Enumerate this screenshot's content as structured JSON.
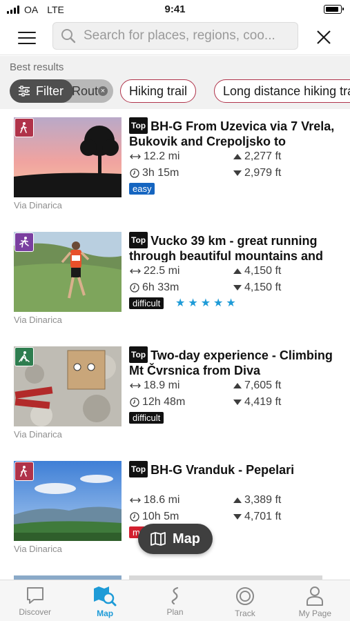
{
  "status_bar": {
    "carrier": "OA",
    "network": "LTE",
    "time": "9:41"
  },
  "search": {
    "placeholder": "Search for places, regions, coo..."
  },
  "filters": {
    "section_label": "Best results",
    "filter_button": "Filter",
    "active_chip": "Route",
    "chips": [
      "Hiking trail",
      "Long distance hiking trail"
    ]
  },
  "tours": [
    {
      "badge": "Top",
      "title": "BH-G From Uzevica via 7 Vrela, Bukovik and Crepoljsko to",
      "distance": "12.2 mi",
      "duration": "3h 15m",
      "ascent": "2,277 ft",
      "descent": "2,979 ft",
      "difficulty": "easy",
      "difficulty_color": "#1565c0",
      "rating": "",
      "source": "Via Dinarica",
      "category_icon": "hiking-icon",
      "category_color": "#b0334a"
    },
    {
      "badge": "Top",
      "title": "Vucko 39 km - great running through beautiful mountains and",
      "distance": "22.5 mi",
      "duration": "6h 33m",
      "ascent": "4,150 ft",
      "descent": "4,150 ft",
      "difficulty": "difficult",
      "difficulty_color": "#111111",
      "rating": "★★★★★",
      "source": "Via Dinarica",
      "category_icon": "running-icon",
      "category_color": "#7a3fa0"
    },
    {
      "badge": "Top",
      "title": "Two-day experience - Climbing Mt Čvrsnica from Diva",
      "distance": "18.9 mi",
      "duration": "12h 48m",
      "ascent": "7,605 ft",
      "descent": "4,419 ft",
      "difficulty": "difficult",
      "difficulty_color": "#111111",
      "rating": "",
      "source": "Via Dinarica",
      "category_icon": "mountain-hike-icon",
      "category_color": "#2e7d4f"
    },
    {
      "badge": "Top",
      "title": "BH-G Vranduk - Pepelari",
      "distance": "18.6 mi",
      "duration": "10h 5m",
      "ascent": "3,389 ft",
      "descent": "4,701 ft",
      "difficulty": "moderate",
      "difficulty_color": "#d3202f",
      "rating": "",
      "source": "Via Dinarica",
      "category_icon": "hiking-icon",
      "category_color": "#b0334a"
    }
  ],
  "map_button": {
    "label": "Map"
  },
  "tab_bar": [
    {
      "label": "Discover",
      "icon": "discover-icon"
    },
    {
      "label": "Map",
      "icon": "map-icon",
      "active": true
    },
    {
      "label": "Plan",
      "icon": "plan-icon"
    },
    {
      "label": "Track",
      "icon": "track-icon"
    },
    {
      "label": "My Page",
      "icon": "profile-icon"
    }
  ],
  "colors": {
    "accent": "#1e9bd7",
    "chip_border": "#b0334a"
  }
}
